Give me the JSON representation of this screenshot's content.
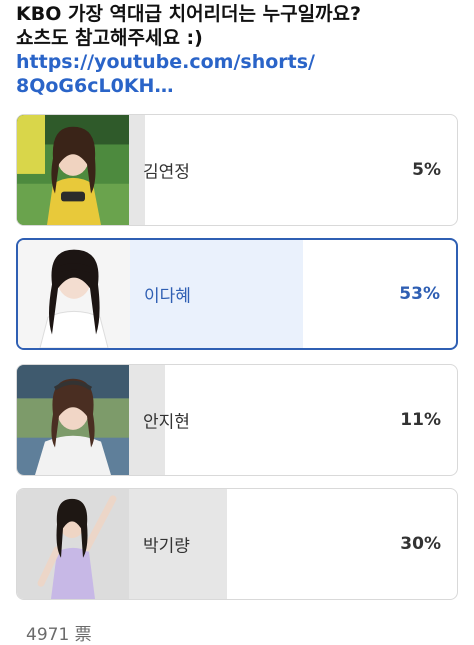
{
  "post": {
    "title_line1": "KBO 가장 역대급 치어리더는 누구일까요?",
    "title_line2": "쇼츠도 참고해주세요 :)",
    "link_line1": "https://youtube.com/shorts/",
    "link_line2": "8QoG6cL0KH…"
  },
  "poll": {
    "options": [
      {
        "name": "김연정",
        "percent_label": "5%",
        "percent": 5,
        "selected": false,
        "photo": "cheerleader-yellow-uniform-photo"
      },
      {
        "name": "이다혜",
        "percent_label": "53%",
        "percent": 53,
        "selected": true,
        "photo": "cheerleader-white-blouse-photo"
      },
      {
        "name": "안지현",
        "percent_label": "11%",
        "percent": 11,
        "selected": false,
        "photo": "cheerleader-white-jersey-photo"
      },
      {
        "name": "박기량",
        "percent_label": "30%",
        "percent": 30,
        "selected": false,
        "photo": "cheerleader-lavender-outfit-photo"
      }
    ],
    "votes_label": "4971 票"
  },
  "colors": {
    "accent": "#2f5fb3",
    "link": "#2a64c8",
    "bar": "#e6e6e6",
    "bar_selected": "#eaf1fc"
  }
}
